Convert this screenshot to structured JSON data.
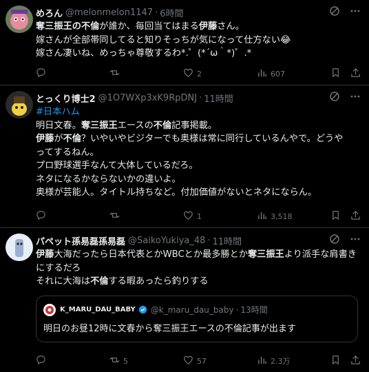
{
  "tweets": [
    {
      "name": "めろん",
      "handle": "@melonmelon1147",
      "time": "6時間",
      "lines": [
        [
          {
            "t": "奪三振王の不倫",
            "b": true
          },
          {
            "t": "が誰か、毎回当てはまる"
          },
          {
            "t": "伊藤",
            "b": true
          },
          {
            "t": "さん。"
          }
        ],
        [
          {
            "t": "嫁さんが全部帯同してると知りそっちが気になって仕方ない😂"
          }
        ],
        [
          {
            "t": "嫁さん凄いね、めっちゃ尊敬するわ*.゜(*´ω｀*)゜.*"
          }
        ]
      ],
      "actions": {
        "reply": "",
        "retweet": "",
        "like": "2",
        "views": "607"
      }
    },
    {
      "name": "とっくり博士2",
      "handle": "@1O7WXp3xK9RpDNJ",
      "time": "11時間",
      "lines": [
        [
          {
            "t": "#日本ハム",
            "h": true
          }
        ],
        [
          {
            "t": "明日文春。"
          },
          {
            "t": "奪三振王",
            "b": true
          },
          {
            "t": "エースの"
          },
          {
            "t": "不倫",
            "b": true
          },
          {
            "t": "記事掲載。"
          }
        ],
        [
          {
            "t": "伊藤",
            "b": true
          },
          {
            "t": "が"
          },
          {
            "t": "不倫",
            "b": true
          },
          {
            "t": "？いやいやビジターでも奥様は常に同行しているんやで。どうや"
          }
        ],
        [
          {
            "t": "ってするねん。"
          }
        ],
        [
          {
            "t": "プロ野球選手なんて大体しているだろ。"
          }
        ],
        [
          {
            "t": "ネタになるかならないかの違いよ。"
          }
        ],
        [
          {
            "t": "奥様が芸能人。タイトル持ちなど。付加価値がないとネタにならん。"
          }
        ]
      ],
      "actions": {
        "reply": "",
        "retweet": "",
        "like": "1",
        "views": "3,518"
      }
    },
    {
      "name": "パペット孫易磊孫易磊",
      "handle": "@SaikoYukiya_48",
      "time": "11時間",
      "lines": [
        [
          {
            "t": "伊藤",
            "b": true
          },
          {
            "t": "大海だったら日本代表とかWBCとか最多勝とか"
          },
          {
            "t": "奪三振王",
            "b": true
          },
          {
            "t": "より派手な肩書きにするだろ"
          }
        ],
        [
          {
            "t": "それに大海は"
          },
          {
            "t": "不倫",
            "b": true
          },
          {
            "t": "する暇あったら釣りする"
          }
        ]
      ],
      "quote": {
        "name": "K_MARU_DAU_BABY",
        "handle": "@k_maru_dau_baby",
        "time": "13時間",
        "text": "明日のお昼12時に文春から奪三振王エースの不倫記事が出ます"
      },
      "actions": {
        "reply": "",
        "retweet": "5",
        "like": "57",
        "views": "2.3万"
      }
    }
  ],
  "separator": "·",
  "colors": {
    "background": "#000000",
    "text": "#e7e9ea",
    "muted": "#71767b",
    "link": "#1d9bf0",
    "border": "#2f3336"
  },
  "icons": [
    "reply-icon",
    "retweet-icon",
    "like-icon",
    "views-icon",
    "bookmark-icon",
    "share-icon",
    "grok-icon",
    "more-icon",
    "verified-icon"
  ]
}
